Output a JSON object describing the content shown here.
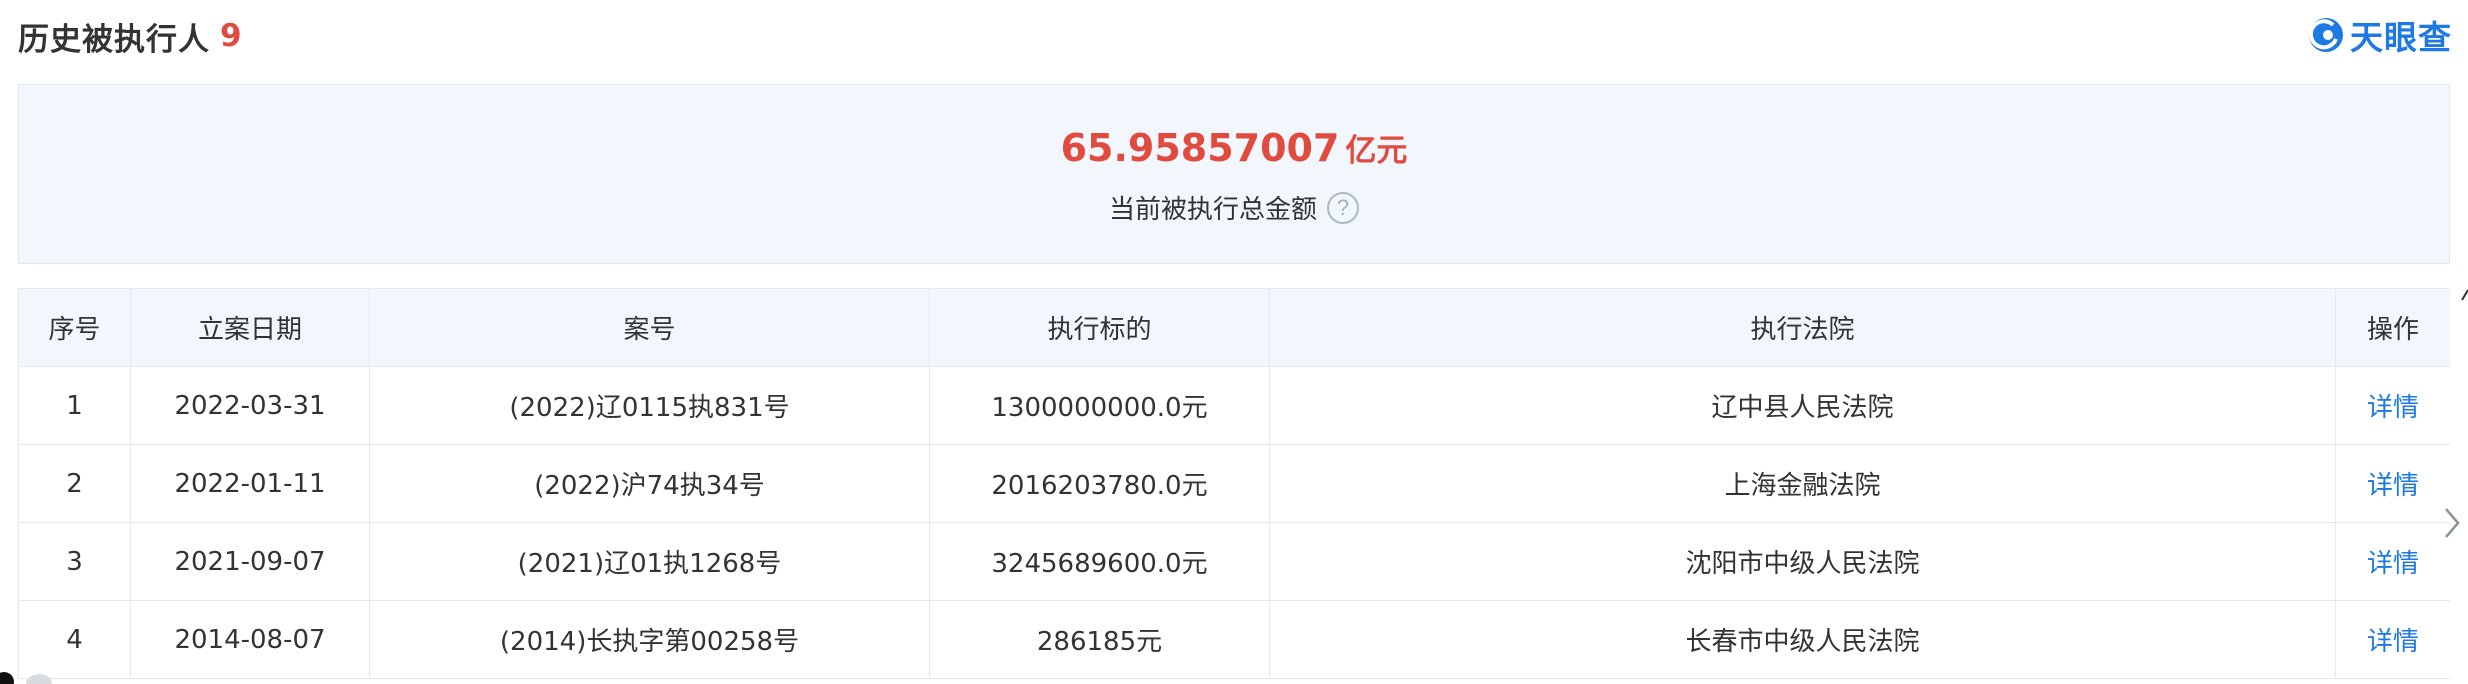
{
  "header": {
    "title": "历史被执行人",
    "count": "9"
  },
  "brand": {
    "name": "天眼查",
    "logo_icon": "tianyancha-logo-icon",
    "color": "#1c79e5"
  },
  "summary": {
    "amount": "65.95857007",
    "unit": "亿元",
    "label": "当前被执行总金额",
    "help_icon": "question-circle-icon",
    "help_glyph": "?",
    "accent_color": "#e04a3f"
  },
  "table": {
    "columns": [
      "序号",
      "立案日期",
      "案号",
      "执行标的",
      "执行法院",
      "操作"
    ],
    "rows": [
      {
        "index": "1",
        "date": "2022-03-31",
        "case_no": "(2022)辽0115执831号",
        "amount": "1300000000.0元",
        "court": "辽中县人民法院",
        "action": "详情"
      },
      {
        "index": "2",
        "date": "2022-01-11",
        "case_no": "(2022)沪74执34号",
        "amount": "2016203780.0元",
        "court": "上海金融法院",
        "action": "详情"
      },
      {
        "index": "3",
        "date": "2021-09-07",
        "case_no": "(2021)辽01执1268号",
        "amount": "3245689600.0元",
        "court": "沈阳市中级人民法院",
        "action": "详情"
      },
      {
        "index": "4",
        "date": "2014-08-07",
        "case_no": "(2014)长执字第00258号",
        "amount": "286185元",
        "court": "长春市中级人民法院",
        "action": "详情"
      }
    ]
  },
  "scroll": {
    "next_icon": "chevron-right-icon"
  }
}
